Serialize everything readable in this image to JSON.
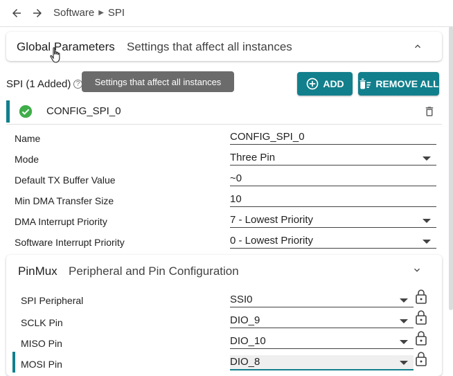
{
  "breadcrumb": {
    "items": [
      "Software",
      "SPI"
    ]
  },
  "global_params": {
    "title": "Global Parameters",
    "subtitle": "Settings that affect all instances"
  },
  "tooltip": {
    "text": "Settings that affect all instances"
  },
  "spi_section": {
    "title": "SPI (1 Added)",
    "help_glyph": "?"
  },
  "buttons": {
    "add": "ADD",
    "remove_all": "REMOVE ALL"
  },
  "instance": {
    "name": "CONFIG_SPI_0",
    "status": "valid"
  },
  "properties": [
    {
      "label": "Name",
      "value": "CONFIG_SPI_0",
      "dropdown": false
    },
    {
      "label": "Mode",
      "value": "Three Pin",
      "dropdown": true
    },
    {
      "label": "Default TX Buffer Value",
      "value": "~0",
      "dropdown": false
    },
    {
      "label": "Min DMA Transfer Size",
      "value": "10",
      "dropdown": false
    },
    {
      "label": "DMA Interrupt Priority",
      "value": "7 - Lowest Priority",
      "dropdown": true
    },
    {
      "label": "Software Interrupt Priority",
      "value": "0 - Lowest Priority",
      "dropdown": true
    }
  ],
  "pinmux": {
    "title": "PinMux",
    "subtitle": "Peripheral and Pin Configuration",
    "rows": [
      {
        "label": "SPI Peripheral",
        "value": "SSI0"
      },
      {
        "label": "SCLK Pin",
        "value": "DIO_9"
      },
      {
        "label": "MISO Pin",
        "value": "DIO_10"
      },
      {
        "label": "MOSI Pin",
        "value": "DIO_8"
      }
    ]
  },
  "colors": {
    "accent": "#127f8c",
    "success": "#3fae49",
    "tooltip_bg": "#6b6b6b"
  }
}
